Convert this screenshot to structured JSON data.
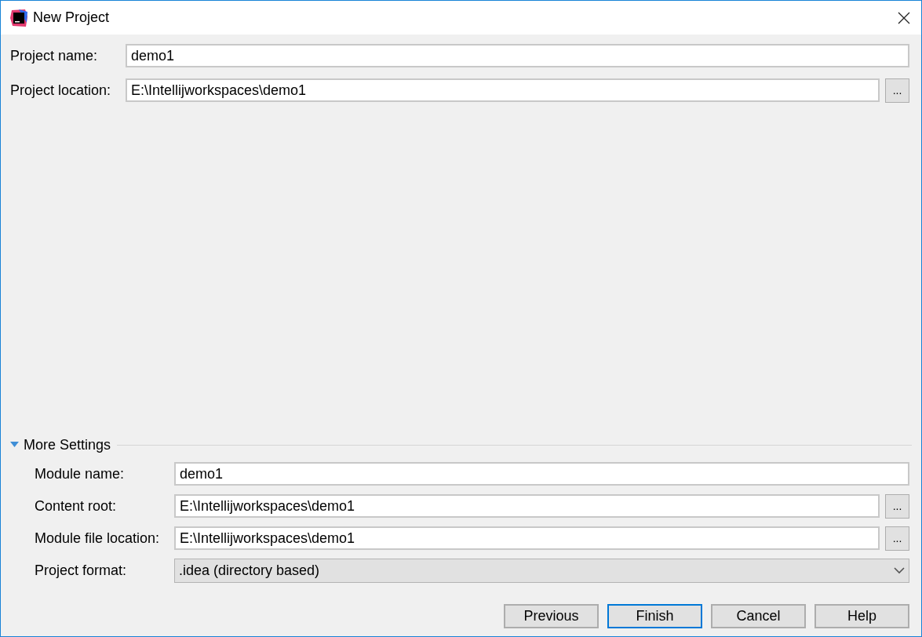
{
  "window": {
    "title": "New Project"
  },
  "project_fields": [
    {
      "label": "Project name:",
      "value": "demo1",
      "kind": "text"
    },
    {
      "label": "Project location:",
      "value": "E:\\Intellijworkspaces\\demo1",
      "kind": "text",
      "browse": "..."
    }
  ],
  "more_settings": {
    "label": "More Settings",
    "expanded": true,
    "fields": [
      {
        "label": "Module name:",
        "value": "demo1",
        "kind": "text"
      },
      {
        "label": "Content root:",
        "value": "E:\\Intellijworkspaces\\demo1",
        "kind": "text",
        "browse": "..."
      },
      {
        "label": "Module file location:",
        "value": "E:\\Intellijworkspaces\\demo1",
        "kind": "text",
        "browse": "..."
      },
      {
        "label": "Project format:",
        "value": ".idea (directory based)",
        "kind": "dropdown"
      }
    ]
  },
  "buttons": [
    {
      "label": "Previous",
      "focused": false
    },
    {
      "label": "Finish",
      "focused": true
    },
    {
      "label": "Cancel",
      "focused": false
    },
    {
      "label": "Help",
      "focused": false
    }
  ]
}
